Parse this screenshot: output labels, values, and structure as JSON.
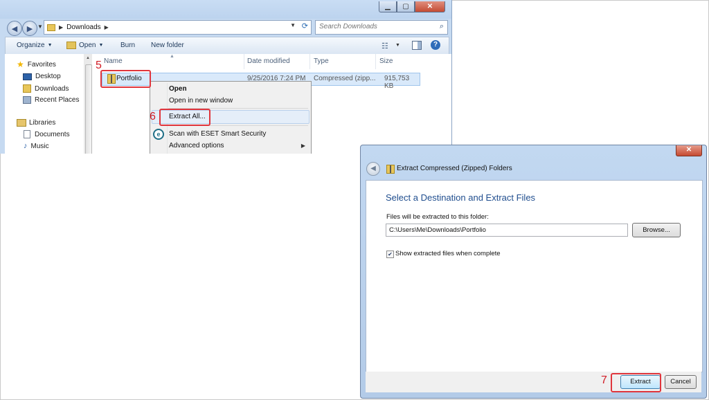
{
  "explorer": {
    "address": {
      "location": "Downloads"
    },
    "search": {
      "placeholder": "Search Downloads"
    },
    "toolbar": {
      "organize": "Organize",
      "open": "Open",
      "burn": "Burn",
      "new_folder": "New folder"
    },
    "nav": {
      "favorites": "Favorites",
      "desktop": "Desktop",
      "downloads": "Downloads",
      "recent_places": "Recent Places",
      "libraries": "Libraries",
      "documents": "Documents",
      "music": "Music"
    },
    "columns": {
      "name": "Name",
      "date_modified": "Date modified",
      "type": "Type",
      "size": "Size"
    },
    "file": {
      "name": "Portfolio",
      "date_modified": "9/25/2016 7:24 PM",
      "type": "Compressed (zipp...",
      "size": "915,753 KB"
    },
    "context_menu": {
      "open": "Open",
      "open_new_window": "Open in new window",
      "extract_all": "Extract All...",
      "scan": "Scan with ESET Smart Security",
      "advanced": "Advanced options"
    }
  },
  "dialog": {
    "title": "Extract Compressed (Zipped) Folders",
    "heading": "Select a Destination and Extract Files",
    "path_label": "Files will be extracted to this folder:",
    "path_value": "C:\\Users\\Me\\Downloads\\Portfolio",
    "browse": "Browse...",
    "show_files_label": "Show extracted files when complete",
    "show_files_checked": true,
    "extract": "Extract",
    "cancel": "Cancel"
  },
  "callouts": {
    "step5": "5",
    "step6": "6",
    "step7": "7"
  },
  "colors": {
    "callout": "#e0353c",
    "dialog_heading": "#1f4d8e",
    "selection": "#d9e9fa"
  },
  "icons": {
    "favorites": "star-icon",
    "desktop": "desktop-icon",
    "downloads": "downloads-folder-icon",
    "recent": "recent-places-icon",
    "libraries": "libraries-icon",
    "documents": "documents-icon",
    "music": "music-icon",
    "zip": "zip-folder-icon",
    "eset": "eset-icon"
  }
}
